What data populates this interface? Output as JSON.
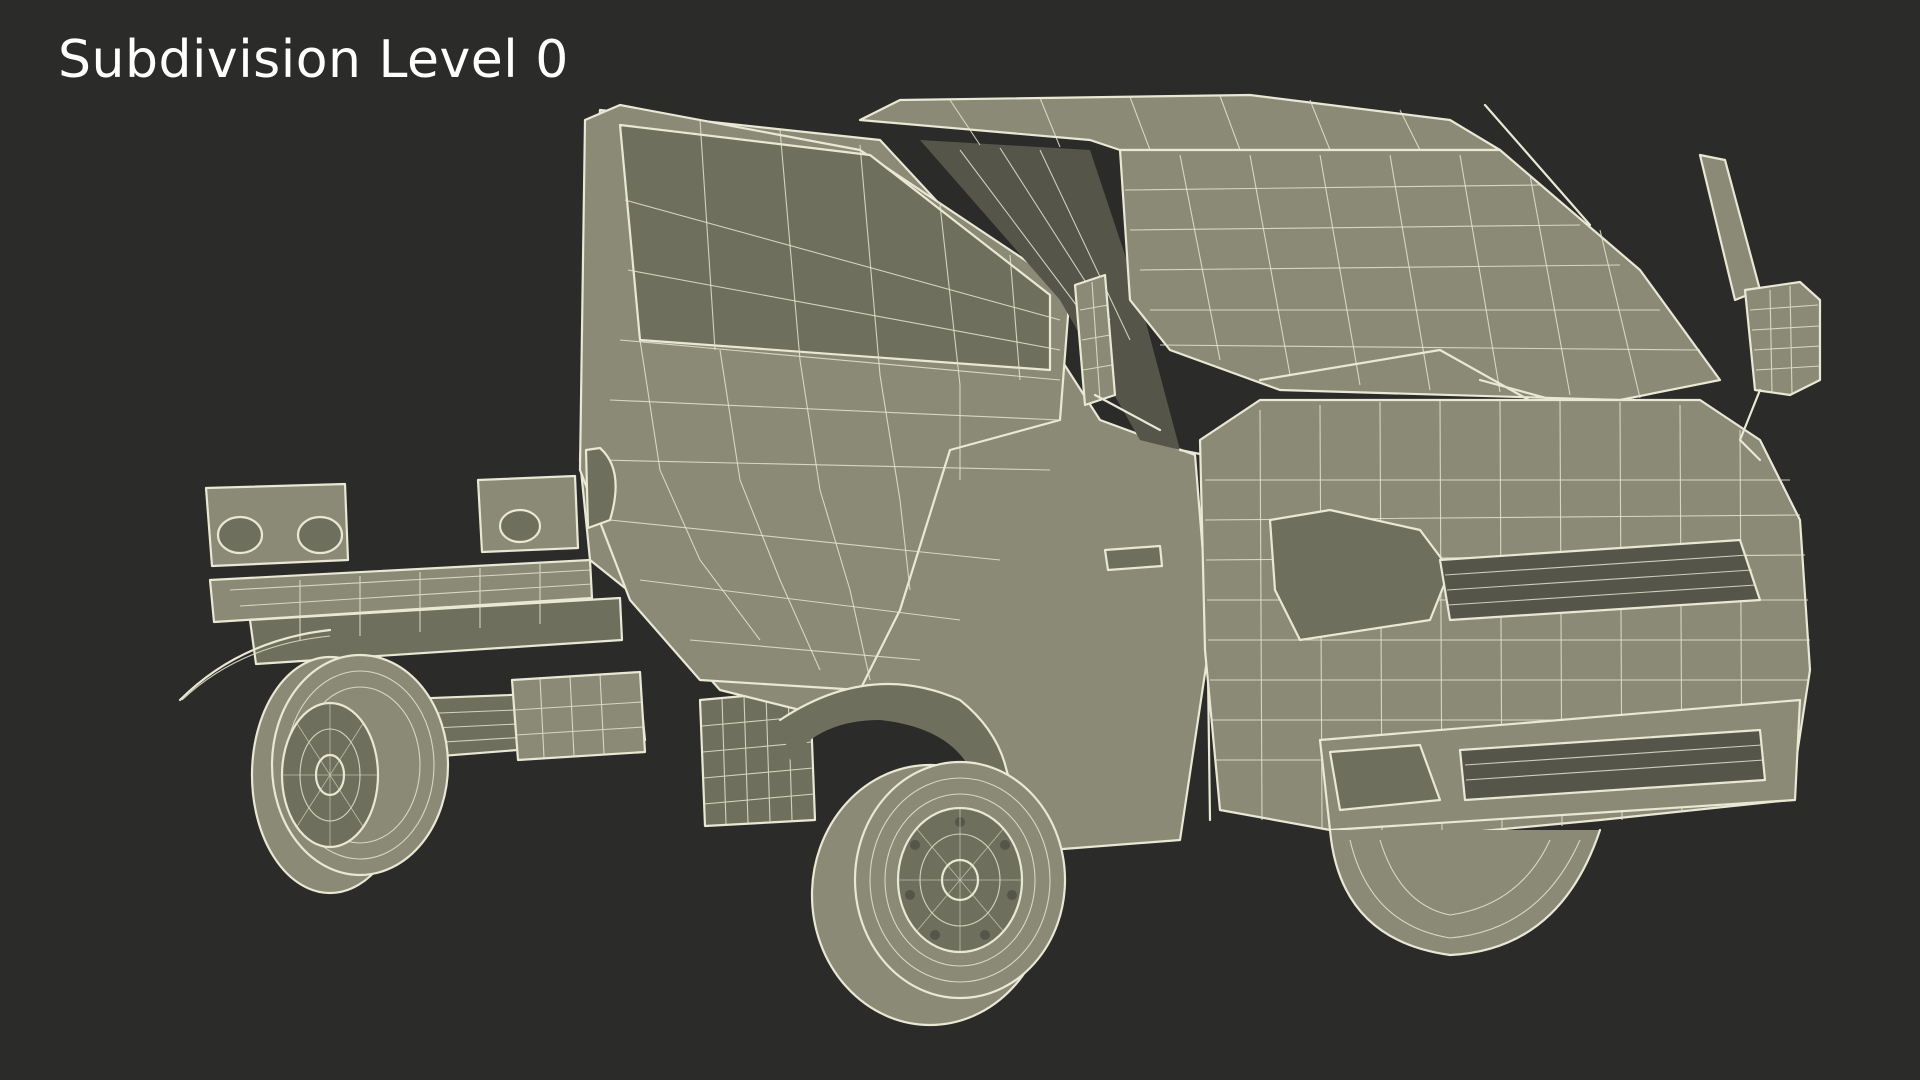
{
  "viewport": {
    "label": "Subdivision Level 0"
  },
  "colors": {
    "background": "#2b2b29",
    "mesh_fill": "#8a8a76",
    "wire": "#e8e8d4",
    "label_text": "#ffffff"
  }
}
